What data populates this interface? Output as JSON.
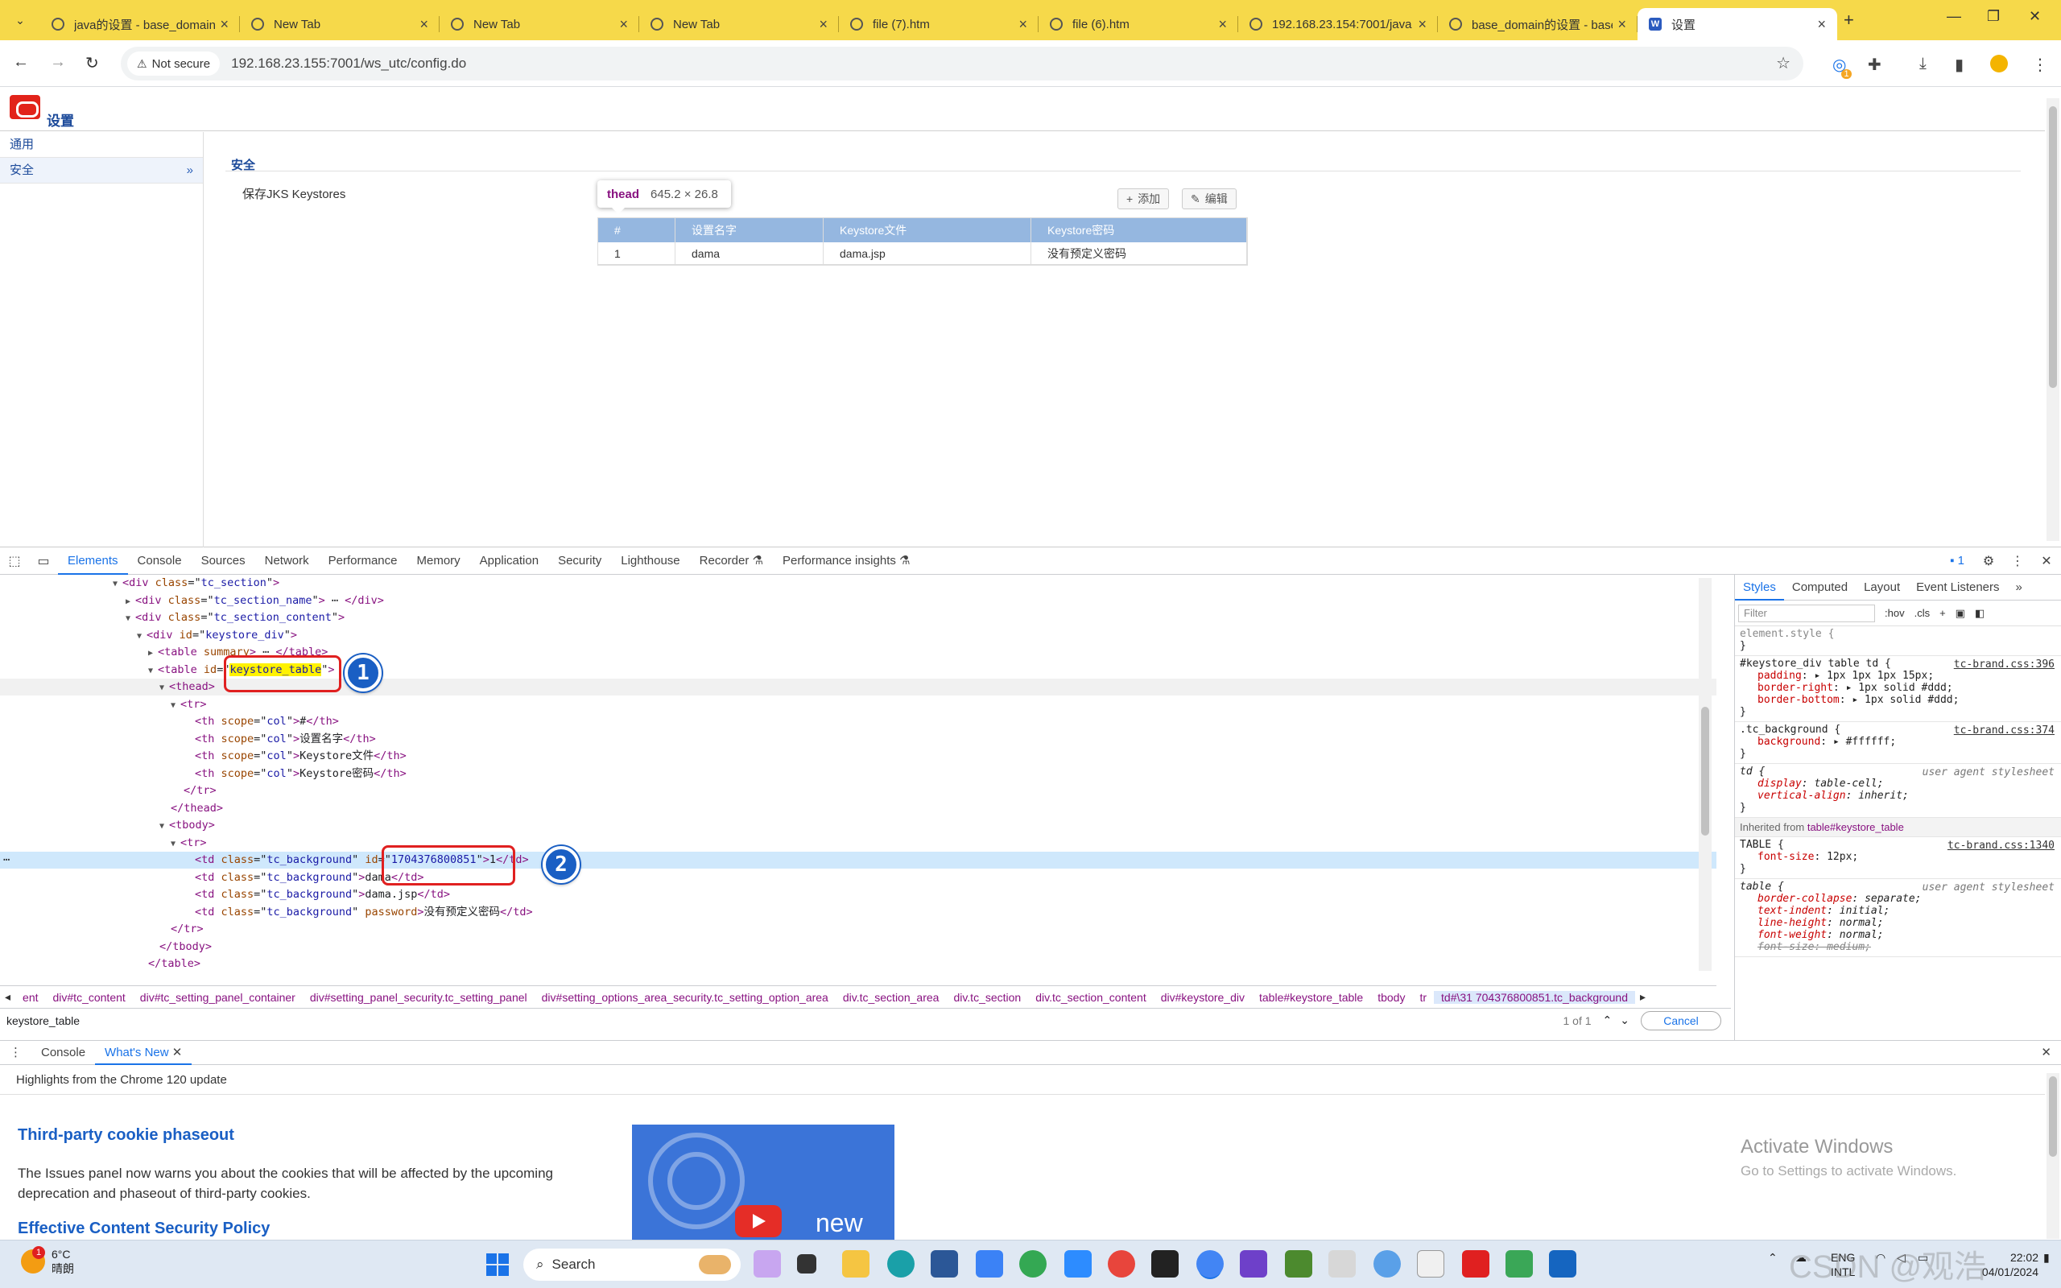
{
  "browser": {
    "tabs": [
      {
        "title": "java的设置 - base_domain",
        "active": false
      },
      {
        "title": "New Tab",
        "active": false
      },
      {
        "title": "New Tab",
        "active": false
      },
      {
        "title": "New Tab",
        "active": false
      },
      {
        "title": "file (7).htm",
        "active": false
      },
      {
        "title": "file (6).htm",
        "active": false
      },
      {
        "title": "192.168.23.154:7001/java",
        "active": false
      },
      {
        "title": "base_domain的设置 - base",
        "active": false
      },
      {
        "title": "设置",
        "active": true
      }
    ],
    "security_chip": "Not secure",
    "url": "192.168.23.155:7001/ws_utc/config.do",
    "extension_badge": "1"
  },
  "page": {
    "title": "设置",
    "nav": [
      {
        "label": "通用"
      },
      {
        "label": "安全",
        "chevron": "»"
      }
    ],
    "section_title": "安全",
    "setting_label": "保存JKS Keystores",
    "tooltip": {
      "tag": "thead",
      "size": "645.2 × 26.8"
    },
    "buttons": {
      "add": "添加",
      "edit": "编辑"
    },
    "table": {
      "headers": [
        "#",
        "设置名字",
        "Keystore文件",
        "Keystore密码"
      ],
      "rows": [
        [
          "1",
          "dama",
          "dama.jsp",
          "没有预定义密码"
        ]
      ]
    }
  },
  "devtools": {
    "tabs": [
      "Elements",
      "Console",
      "Sources",
      "Network",
      "Performance",
      "Memory",
      "Application",
      "Security",
      "Lighthouse",
      "Recorder ⚗",
      "Performance insights ⚗"
    ],
    "issues_count": "1",
    "dom": {
      "l0": {
        "tag": "div",
        "attr": "class",
        "val": "tc_section"
      },
      "l1": {
        "tag": "div",
        "attr": "class",
        "val": "tc_section_name",
        "tail": "</div>"
      },
      "l2": {
        "tag": "div",
        "attr": "class",
        "val": "tc_section_content"
      },
      "l3": {
        "tag": "div",
        "attr": "id",
        "val": "keystore_div"
      },
      "l4": {
        "tag": "table",
        "attr": "summary",
        "tail": "</table>"
      },
      "l5": {
        "tag": "table",
        "attr": "id",
        "val": "keystore_table"
      },
      "l6": "<thead>",
      "l7": "<tr>",
      "th": [
        {
          "attr": "scope",
          "val": "col",
          "text": "#"
        },
        {
          "attr": "scope",
          "val": "col",
          "text": "设置名字"
        },
        {
          "attr": "scope",
          "val": "col",
          "text": "Keystore文件"
        },
        {
          "attr": "scope",
          "val": "col",
          "text": "Keystore密码"
        }
      ],
      "l12": "</tr>",
      "l13": "</thead>",
      "l14": "<tbody>",
      "l15": "<tr>",
      "td": [
        {
          "class": "tc_background",
          "attr": "id",
          "val": "1704376800851",
          "text": "1"
        },
        {
          "class": "tc_background",
          "text": "dama"
        },
        {
          "class": "tc_background",
          "text": "dama.jsp"
        },
        {
          "class": "tc_background",
          "attr": "password",
          "text": "没有预定义密码"
        }
      ],
      "l20": "</tr>",
      "l21": "</tbody>",
      "l22": "</table>"
    },
    "badges": [
      "1",
      "2"
    ],
    "breadcrumbs": [
      "ent",
      "div#tc_content",
      "div#tc_setting_panel_container",
      "div#setting_panel_security.tc_setting_panel",
      "div#setting_options_area_security.tc_setting_option_area",
      "div.tc_section_area",
      "div.tc_section",
      "div.tc_section_content",
      "div#keystore_div",
      "table#keystore_table",
      "tbody",
      "tr",
      "td#\\31 704376800851.tc_background"
    ],
    "search": {
      "query": "keystore_table",
      "count": "1 of 1",
      "cancel": "Cancel"
    },
    "styles": {
      "tabs": [
        "Styles",
        "Computed",
        "Layout",
        "Event Listeners"
      ],
      "filter_placeholder": "Filter",
      "hov": ":hov",
      "cls": ".cls",
      "element_style": "element.style {",
      "rule1": {
        "selector": "#keystore_div table td {",
        "source": "tc-brand.css:396",
        "props": [
          [
            "padding",
            "▸ 1px 1px 1px 15px;"
          ],
          [
            "border-right",
            "▸ 1px solid  #ddd;"
          ],
          [
            "border-bottom",
            "▸ 1px solid  #ddd;"
          ]
        ]
      },
      "rule2": {
        "selector": ".tc_background {",
        "source": "tc-brand.css:374",
        "props": [
          [
            "background",
            "▸  #ffffff;"
          ]
        ]
      },
      "rule3": {
        "selector": "td {",
        "source": "user agent stylesheet",
        "props": [
          [
            "display",
            "table-cell;"
          ],
          [
            "vertical-align",
            "inherit;"
          ]
        ]
      },
      "inherited_label": "Inherited from",
      "inherited_link": "table#keystore_table",
      "rule4": {
        "selector": "TABLE {",
        "source": "tc-brand.css:1340",
        "props": [
          [
            "font-size",
            "12px;"
          ]
        ]
      },
      "rule5": {
        "selector": "table {",
        "source": "user agent stylesheet",
        "props": [
          [
            "border-collapse",
            "separate;"
          ],
          [
            "text-indent",
            "initial;"
          ],
          [
            "line-height",
            "normal;"
          ],
          [
            "font-weight",
            "normal;"
          ],
          [
            "font-size",
            "medium;"
          ]
        ]
      }
    },
    "colors": {
      "accent": "#1a73e8",
      "tag": "#881280",
      "attr_name": "#994500",
      "attr_value": "#1a1aa6",
      "callout": "#e02020",
      "badge": "#1a5fc4"
    }
  },
  "drawer": {
    "tabs": [
      "Console",
      "What's New"
    ],
    "highlights": "Highlights from the Chrome 120 update",
    "feature1_title": "Third-party cookie phaseout",
    "feature1_desc": "The Issues panel now warns you about the cookies that will be affected by the upcoming deprecation and phaseout of third-party cookies.",
    "feature2_title": "Effective Content Security Policy",
    "promo_text": "new",
    "activate_title": "Activate Windows",
    "activate_sub": "Go to Settings to activate Windows."
  },
  "taskbar": {
    "temp": "6°C",
    "weather_desc": "晴朗",
    "weather_badge": "1",
    "search": "Search",
    "lang": "ENG",
    "layout": "INTL",
    "time": "22:02",
    "date": "04/01/2024",
    "watermark": "CSDN @观浩"
  }
}
